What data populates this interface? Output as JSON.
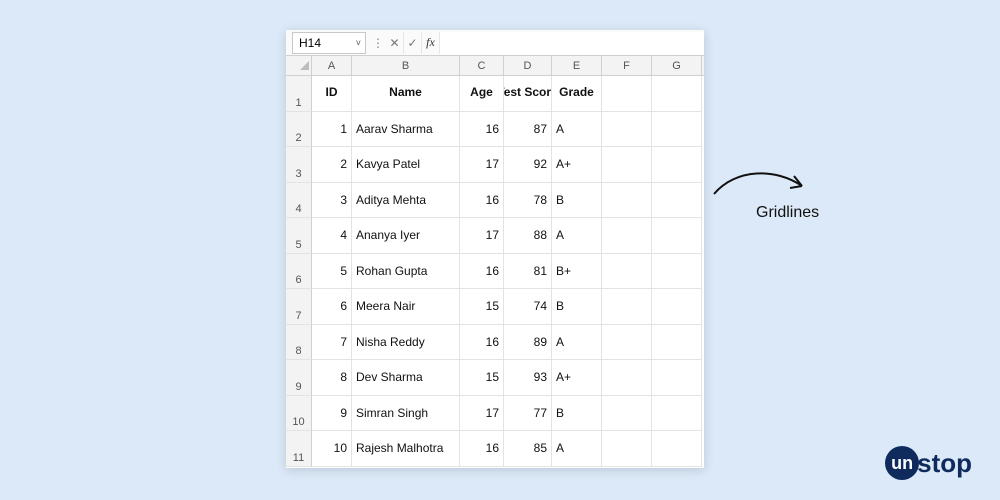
{
  "formula_bar": {
    "cell_ref": "H14",
    "formula_value": ""
  },
  "columns": [
    "A",
    "B",
    "C",
    "D",
    "E",
    "F",
    "G"
  ],
  "row_numbers": [
    1,
    2,
    3,
    4,
    5,
    6,
    7,
    8,
    9,
    10,
    11
  ],
  "headers": {
    "id": "ID",
    "name": "Name",
    "age": "Age",
    "score": "Test Score",
    "grade": "Grade"
  },
  "rows": [
    {
      "id": 1,
      "name": "Aarav Sharma",
      "age": 16,
      "score": 87,
      "grade": "A"
    },
    {
      "id": 2,
      "name": "Kavya Patel",
      "age": 17,
      "score": 92,
      "grade": "A+"
    },
    {
      "id": 3,
      "name": "Aditya Mehta",
      "age": 16,
      "score": 78,
      "grade": "B"
    },
    {
      "id": 4,
      "name": "Ananya Iyer",
      "age": 17,
      "score": 88,
      "grade": "A"
    },
    {
      "id": 5,
      "name": "Rohan Gupta",
      "age": 16,
      "score": 81,
      "grade": "B+"
    },
    {
      "id": 6,
      "name": "Meera Nair",
      "age": 15,
      "score": 74,
      "grade": "B"
    },
    {
      "id": 7,
      "name": "Nisha Reddy",
      "age": 16,
      "score": 89,
      "grade": "A"
    },
    {
      "id": 8,
      "name": "Dev Sharma",
      "age": 15,
      "score": 93,
      "grade": "A+"
    },
    {
      "id": 9,
      "name": "Simran Singh",
      "age": 17,
      "score": 77,
      "grade": "B"
    },
    {
      "id": 10,
      "name": "Rajesh Malhotra",
      "age": 16,
      "score": 85,
      "grade": "A"
    }
  ],
  "annotation": {
    "label": "Gridlines"
  },
  "logo": {
    "bubble": "un",
    "rest": "stop"
  }
}
